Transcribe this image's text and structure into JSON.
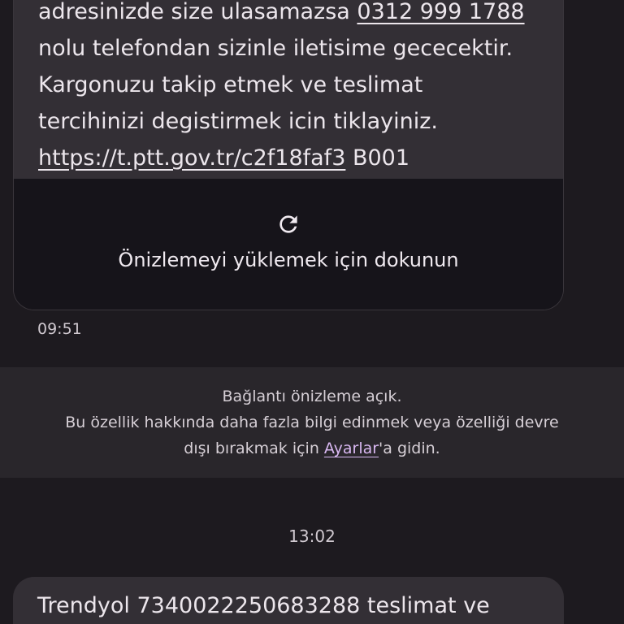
{
  "message_1": {
    "lines": [
      {
        "pre": "adresinizde size ulasamazsa ",
        "link": "0312 999 1788",
        "post": ""
      },
      {
        "pre": "nolu telefondan sizinle iletisime gececektir.",
        "link": "",
        "post": ""
      },
      {
        "pre": "Kargonuzu takip etmek ve teslimat",
        "link": "",
        "post": ""
      },
      {
        "pre": "tercihinizi degistirmek icin tiklayiniz.",
        "link": "",
        "post": ""
      }
    ],
    "url": "https://t.ptt.gov.tr/c2f18faf3",
    "url_suffix": " B001",
    "preview_label": "Önizlemeyi yüklemek için dokunun",
    "preview_icon": "refresh-icon",
    "time": "09:51"
  },
  "notice": {
    "line1": "Bağlantı önizleme açık.",
    "line2": "Bu özellik hakkında daha fazla bilgi edinmek veya özelliği devre",
    "line3_pre": "dışı bırakmak için ",
    "line3_link": "Ayarlar",
    "line3_post": "'a gidin."
  },
  "separator_time": "13:02",
  "message_2": {
    "text": "Trendyol 7340022250683288 teslimat ve"
  },
  "colors": {
    "background": "#1d1a1f",
    "bubble": "#332f35",
    "preview": "#16141a",
    "notice_bg": "#29262b",
    "link_accent": "#d9b8f2"
  }
}
